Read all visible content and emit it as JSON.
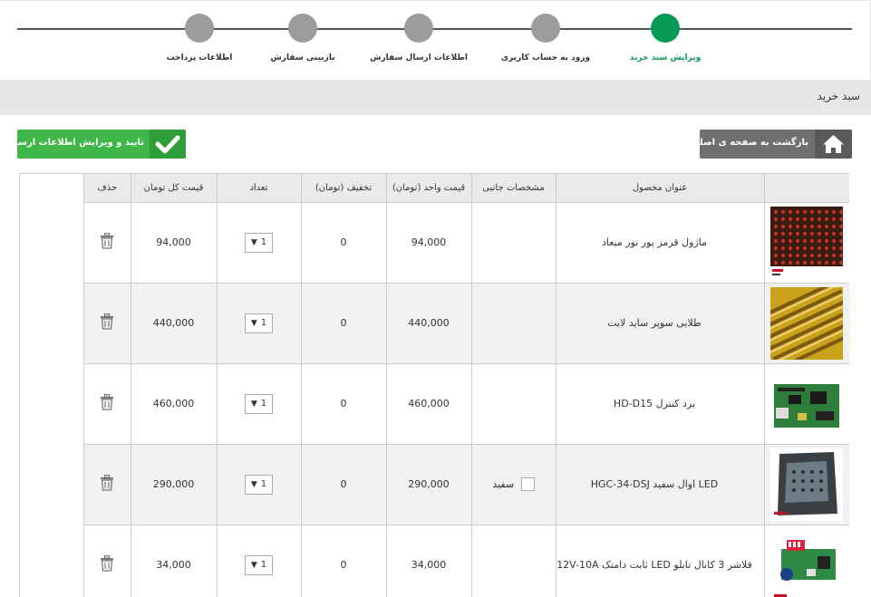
{
  "steps": [
    {
      "label": "ویرایش سبد خرید",
      "active": true
    },
    {
      "label": "ورود به حساب کاربری",
      "active": false
    },
    {
      "label": "اطلاعات ارسال سفارش",
      "active": false
    },
    {
      "label": "بازبینی سفارش",
      "active": false
    },
    {
      "label": "اطلاعات پرداخت",
      "active": false
    }
  ],
  "page_title": "سبد خرید",
  "buttons": {
    "home_label": "بازگشت به صفحه ی اصلی",
    "confirm_label": "تایید و ویرایش اطلاعات ارسال"
  },
  "table": {
    "headers": {
      "title": "عنوان محصول",
      "attributes": "مشخصات جانبی",
      "unit_price": "قیمت واحد (تومان)",
      "discount": "تخفیف (تومان)",
      "quantity": "تعداد",
      "total": "قیمت کل تومان",
      "delete": "حذف"
    },
    "rows": [
      {
        "title": "ماژول قرمز پور نور میعاد",
        "attribute": "",
        "unit_price": "94,000",
        "discount": "0",
        "quantity": "1",
        "total": "94,000"
      },
      {
        "title": "طلایی سوپر ساید لایت",
        "attribute": "",
        "unit_price": "440,000",
        "discount": "0",
        "quantity": "1",
        "total": "440,000"
      },
      {
        "title": "برد کنترل HD-D15",
        "attribute": "",
        "unit_price": "460,000",
        "discount": "0",
        "quantity": "1",
        "total": "460,000"
      },
      {
        "title": "LED اوال سفید HGC-34-DSJ",
        "attribute": "سفید",
        "unit_price": "290,000",
        "discount": "0",
        "quantity": "1",
        "total": "290,000"
      },
      {
        "title": "فلاشر 3 کانال تابلو LED ثابت دامتک 12V-10A",
        "attribute": "",
        "unit_price": "34,000",
        "discount": "0",
        "quantity": "1",
        "total": "34,000"
      }
    ]
  },
  "colors": {
    "active_step": "#079a55",
    "inactive_step": "#9c9c9c",
    "confirm_button": "#3eb648",
    "home_button": "#707070"
  },
  "icons": {
    "home": "home-icon",
    "check": "check-icon",
    "delete": "trash-icon",
    "dropdown": "dropdown-arrow-icon"
  }
}
